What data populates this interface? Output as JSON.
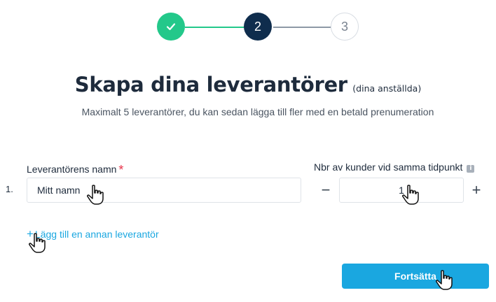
{
  "stepper": {
    "steps": [
      {
        "label": "✓",
        "state": "done"
      },
      {
        "label": "2",
        "state": "active"
      },
      {
        "label": "3",
        "state": "upcoming"
      }
    ],
    "colors": {
      "done": "#23c88a",
      "active": "#0f2d4d",
      "line_done": "#23c88a",
      "line_active": "#8d99a6"
    }
  },
  "header": {
    "title": "Skapa dina leverantörer",
    "title_note": "(dina anställda)",
    "subtitle": "Maximalt 5 leverantörer, du kan sedan lägga till fler med en betald prenumeration"
  },
  "form": {
    "name_label": "Leverantörens namn",
    "required_mark": "*",
    "customers_label": "Nbr av kunder vid samma tidpunkt",
    "info_icon": "i",
    "rows": [
      {
        "number": "1.",
        "name": "Mitt namn",
        "customers": "1"
      }
    ],
    "minus_label": "−",
    "plus_label": "+",
    "add_link": {
      "plus": "+",
      "label": "Lägg till en annan leverantör"
    },
    "continue_label": "Fortsätta",
    "accent_color": "#1aa7e0"
  }
}
